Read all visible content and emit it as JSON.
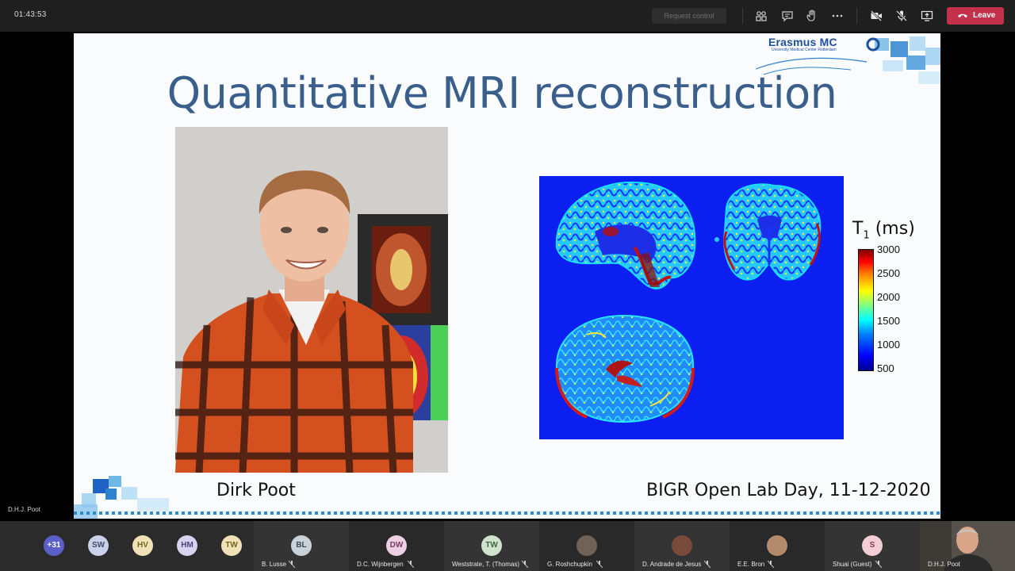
{
  "meeting": {
    "timer": "01:43:53",
    "request_control_label": "Request control",
    "leave_label": "Leave",
    "presenter_label": "D.H.J. Poot"
  },
  "slide": {
    "title": "Quantitative MRI reconstruction",
    "logo_name": "Erasmus MC",
    "logo_sub": "University Medical Center Rotterdam",
    "colorbar_title": "T",
    "colorbar_sub": "1",
    "colorbar_unit": " (ms)",
    "colorbar_ticks": [
      "3000",
      "2500",
      "2000",
      "1500",
      "1000",
      "500"
    ],
    "name_caption": "Dirk Poot",
    "event_caption": "BIGR Open Lab Day, 11-12-2020"
  },
  "roster": {
    "overflow_count": "+31",
    "initial_avatars": [
      {
        "initials": "SW",
        "bg": "#c9d2e8",
        "fg": "#3b4a6b"
      },
      {
        "initials": "HV",
        "bg": "#efe2b6",
        "fg": "#7a6420"
      },
      {
        "initials": "HM",
        "bg": "#d7d2ee",
        "fg": "#4b4480"
      },
      {
        "initials": "TW",
        "bg": "#efe2b6",
        "fg": "#7a6420"
      }
    ],
    "participants": [
      {
        "initials": "BL",
        "name": "B. Lusse",
        "bg": "#c9d2d9",
        "fg": "#3c4a56"
      },
      {
        "initials": "DW",
        "name": "D.C. Wijnbergen",
        "bg": "#ecd0e3",
        "fg": "#7b3a67"
      },
      {
        "initials": "TW",
        "name": "Weststrate, T. (Thomas)",
        "bg": "#cfe3cf",
        "fg": "#3c6a3c"
      },
      {
        "initials": "",
        "name": "G. Roshchupkin",
        "bg": "#6f6258",
        "fg": "#ffffff"
      },
      {
        "initials": "",
        "name": "D. Andrade de Jesus",
        "bg": "#7a4a3a",
        "fg": "#ffffff"
      },
      {
        "initials": "",
        "name": "E.E. Bron",
        "bg": "#b08a6a",
        "fg": "#ffffff"
      },
      {
        "initials": "S",
        "name": "Shuai (Guest)",
        "bg": "#f2cfd6",
        "fg": "#8a3a4c"
      }
    ],
    "self_name": "D.H.J. Poot"
  }
}
